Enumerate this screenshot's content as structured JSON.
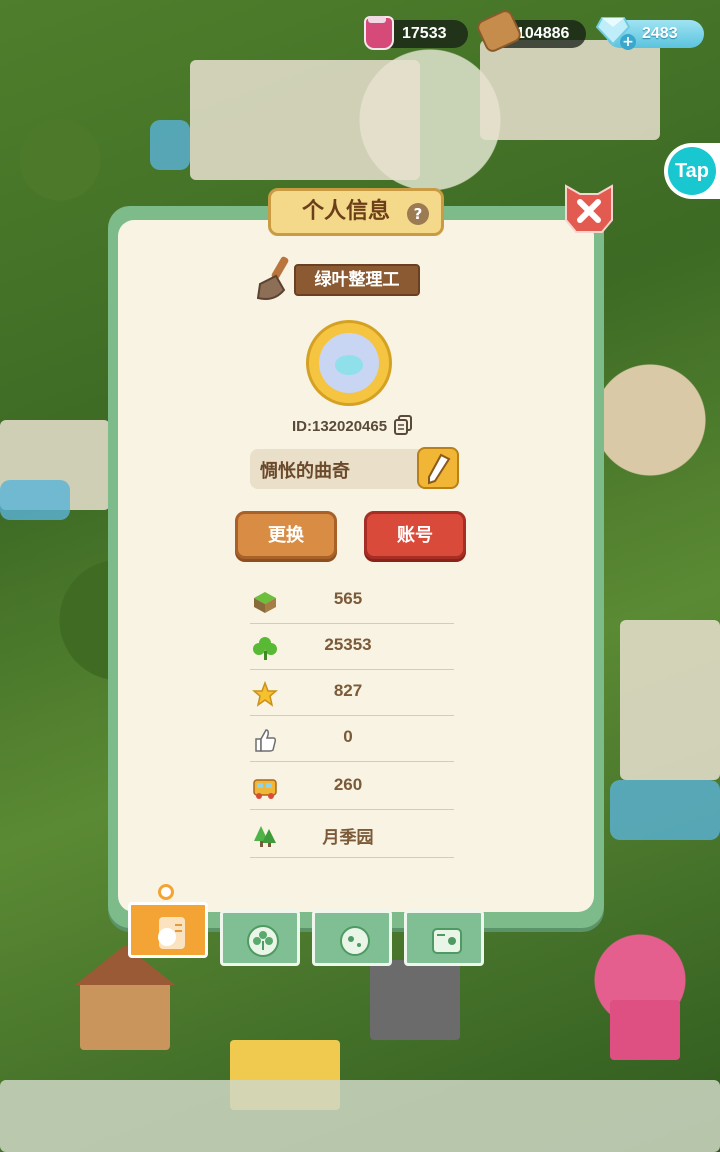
{
  "resources": {
    "jam": "17533",
    "wood": "104886",
    "gems": "2483"
  },
  "tap_label": "Tap",
  "panel": {
    "title": "个人信息",
    "help_icon": "question-icon",
    "rank_title": "绿叶整理工",
    "player_id": "ID:132020465",
    "nickname": "惆怅的曲奇",
    "change_button": "更换",
    "account_button": "账号"
  },
  "stats": [
    {
      "icon": "grass-block-icon",
      "value": "565"
    },
    {
      "icon": "clover-icon",
      "value": "25353"
    },
    {
      "icon": "star-icon",
      "value": "827"
    },
    {
      "icon": "thumbs-up-icon",
      "value": "0"
    },
    {
      "icon": "bus-icon",
      "value": "260"
    },
    {
      "icon": "tree-icon",
      "value": "月季园"
    }
  ],
  "tabs": [
    {
      "icon": "profile-card-icon",
      "active": true
    },
    {
      "icon": "flower-badge-icon",
      "active": false
    },
    {
      "icon": "cookie-icon",
      "active": false
    },
    {
      "icon": "album-icon",
      "active": false
    }
  ],
  "colors": {
    "panel_border": "#7dbb8b",
    "panel_bg": "#f8f3e3",
    "tab_active": "#f3a435",
    "account_button": "#d94a3a",
    "change_button": "#d98c44"
  }
}
